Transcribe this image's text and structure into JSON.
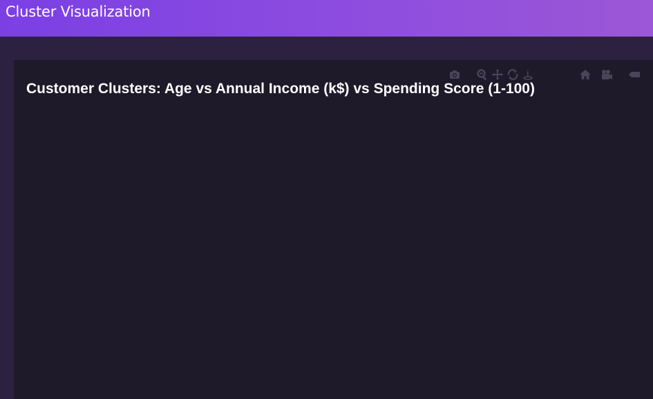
{
  "header": {
    "title": "Cluster Visualization"
  },
  "chart": {
    "title": "Customer Clusters: Age vs Annual Income (k$) vs Spending Score (1-100)"
  },
  "modebar": {
    "icons": [
      "camera-icon",
      "zoom-icon",
      "pan-icon",
      "orbit-rotation-icon",
      "turntable-rotation-icon",
      "home-icon",
      "camera-view-icon",
      "hover-label-icon",
      "plotly-logo"
    ]
  },
  "colors": {
    "header_start": "#7b3fe4",
    "header_end": "#9b57d6",
    "background": "#2c2140",
    "panel": "#1e1a2a",
    "modebar_icon": "#4a4558"
  }
}
